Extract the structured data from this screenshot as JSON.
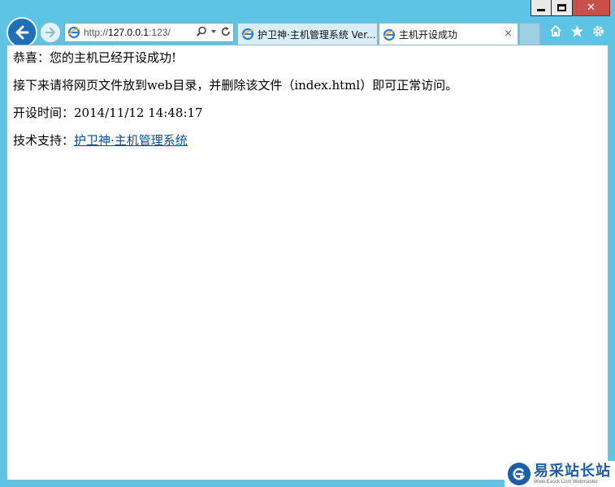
{
  "window": {
    "minimize_icon": "minimize-icon",
    "maximize_icon": "maximize-icon",
    "close_glyph": "✕"
  },
  "address_bar": {
    "url_prefix": "http://",
    "url_host": "127.0.0.1",
    "url_suffix": ":123/"
  },
  "tabs": [
    {
      "label": "护卫神·主机管理系统 Ver...",
      "active": false
    },
    {
      "label": "主机开设成功",
      "active": true,
      "close": "×"
    }
  ],
  "page": {
    "line1": "恭喜：您的主机已经开设成功!",
    "line2": "接下来请将网页文件放到web目录，并删除该文件（index.html）即可正常访问。",
    "line3": "开设时间：2014/11/12 14:48:17",
    "line4_label": "技术支持：",
    "line4_link": "护卫神·主机管理系统"
  },
  "watermark": {
    "title": "易采站长站",
    "subtitle": "Www.Easck.Com Webmaster"
  },
  "colors": {
    "chrome": "#5ec4e6",
    "back_button": "#1d6fb8",
    "link": "#0b4f9a",
    "close_button": "#c7514a"
  }
}
